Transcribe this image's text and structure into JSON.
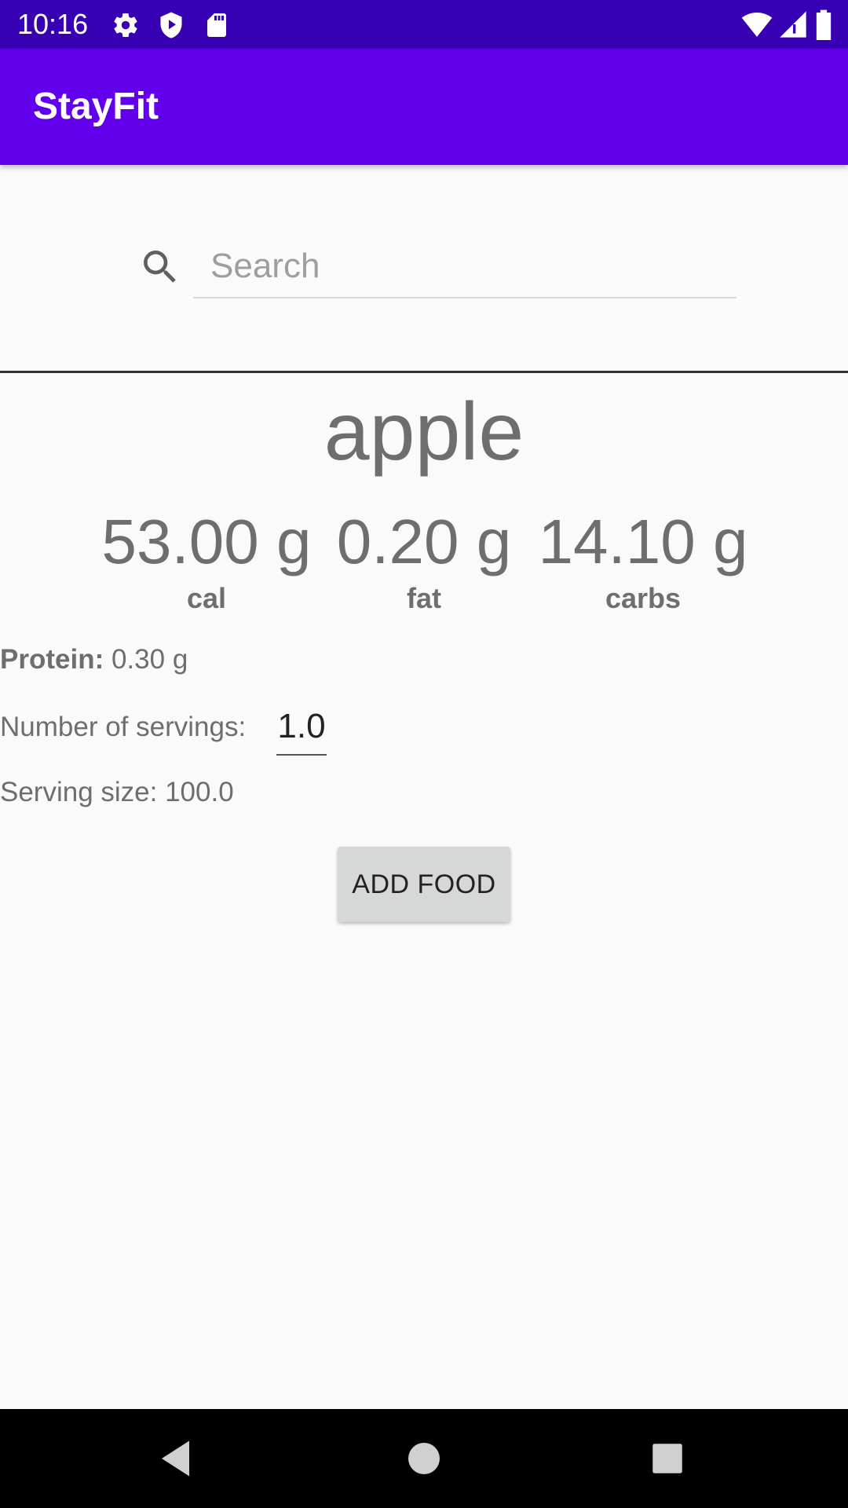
{
  "status_bar": {
    "time": "10:16",
    "icons": [
      "gear-icon",
      "shield-play-icon",
      "sd-card-icon",
      "wifi-icon",
      "signal-icon",
      "battery-icon"
    ]
  },
  "app_bar": {
    "title": "StayFit"
  },
  "search": {
    "placeholder": "Search",
    "value": ""
  },
  "food": {
    "name": "apple",
    "macros": [
      {
        "value": "53.00 g",
        "label": "cal"
      },
      {
        "value": "0.20 g",
        "label": "fat"
      },
      {
        "value": "14.10 g",
        "label": "carbs"
      }
    ],
    "protein_label": "Protein:",
    "protein_value": "0.30 g",
    "servings_label": "Number of servings:",
    "servings_value": "1.0",
    "serving_size_text": "Serving size: 100.0"
  },
  "actions": {
    "add_food_label": "ADD FOOD"
  },
  "nav_bar": {
    "buttons": [
      "back-icon",
      "home-icon",
      "recents-icon"
    ]
  },
  "colors": {
    "status_bar": "#3700b3",
    "app_bar": "#6200ee",
    "text_gray": "#6e6e6e",
    "button_bg": "#d6d7d7"
  }
}
